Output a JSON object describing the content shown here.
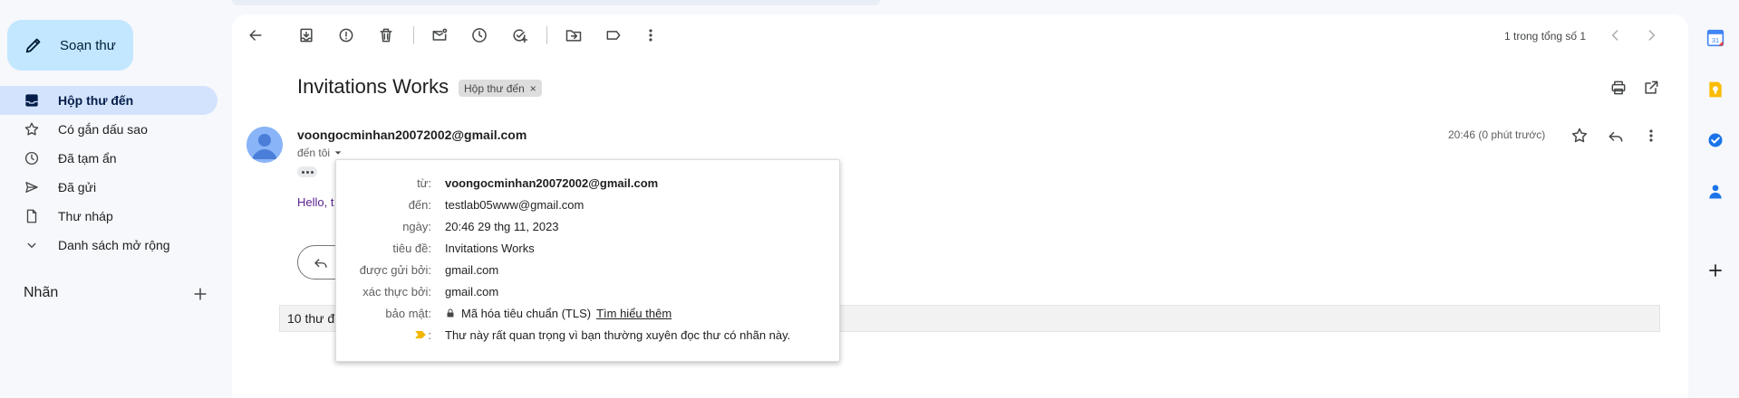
{
  "sidebar": {
    "compose_label": "Soạn thư",
    "items": [
      {
        "label": "Hộp thư đến",
        "icon": "inbox-icon"
      },
      {
        "label": "Có gắn dấu sao",
        "icon": "star-icon"
      },
      {
        "label": "Đã tạm ẩn",
        "icon": "clock-icon"
      },
      {
        "label": "Đã gửi",
        "icon": "send-icon"
      },
      {
        "label": "Thư nháp",
        "icon": "draft-icon"
      },
      {
        "label": "Danh sách mở rộng",
        "icon": "chevron-down-icon"
      }
    ],
    "labels_heading": "Nhãn"
  },
  "toolbar": {
    "page_count": "1 trong tổng số 1"
  },
  "message": {
    "subject": "Invitations Works",
    "label_chip": "Hộp thư đến",
    "label_chip_close": "×",
    "sender": "voongocminhan20072002@gmail.com",
    "to_me": "đến tôi",
    "time": "20:46 (0 phút trước)",
    "body_preview": "Hello, t",
    "thread_bar": "10 thư đ"
  },
  "details": {
    "rows": [
      {
        "key": "từ:",
        "value": "voongocminhan20072002@gmail.com"
      },
      {
        "key": "đến:",
        "value": "testlab05www@gmail.com"
      },
      {
        "key": "ngày:",
        "value": "20:46 29 thg 11, 2023"
      },
      {
        "key": "tiêu đề:",
        "value": "Invitations Works"
      },
      {
        "key": "được gửi bởi:",
        "value": "gmail.com"
      },
      {
        "key": "xác thực bởi:",
        "value": "gmail.com"
      },
      {
        "key": "bảo mật:",
        "value": "Mã hóa tiêu chuẩn (TLS)",
        "link": "Tìm hiểu thêm"
      },
      {
        "key": ":",
        "value": "Thư này rất quan trọng vì bạn thường xuyên đọc thư có nhãn này."
      }
    ]
  },
  "colors": {
    "compose_bg": "#c2e7ff",
    "active_nav_bg": "#d3e3fd",
    "importance_marker": "#f2b600"
  }
}
